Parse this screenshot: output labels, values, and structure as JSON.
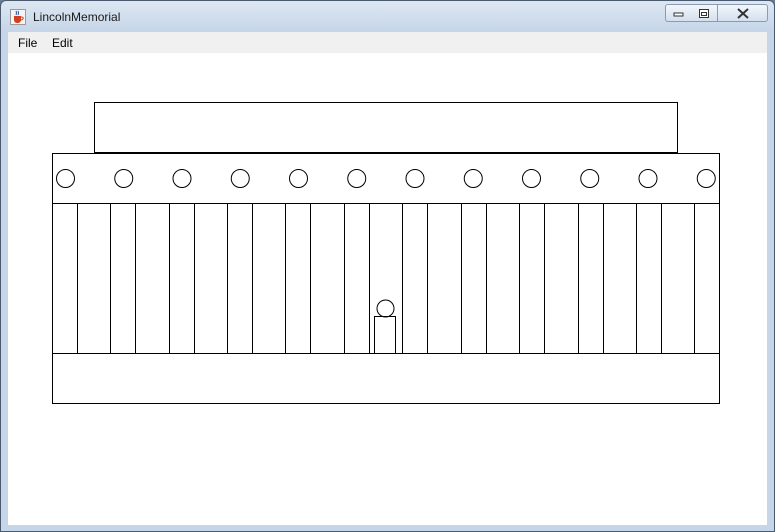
{
  "window": {
    "title": "LincolnMemorial",
    "app_icon": "java-cup-icon",
    "controls": [
      "minimize-icon",
      "restore-icon",
      "close-icon"
    ]
  },
  "menu": {
    "items": [
      {
        "label": "File"
      },
      {
        "label": "Edit"
      }
    ]
  },
  "colors": {
    "canvas_background": "#ffffff",
    "stroke": "#000000",
    "titlebar": "#c6d6e8"
  }
}
